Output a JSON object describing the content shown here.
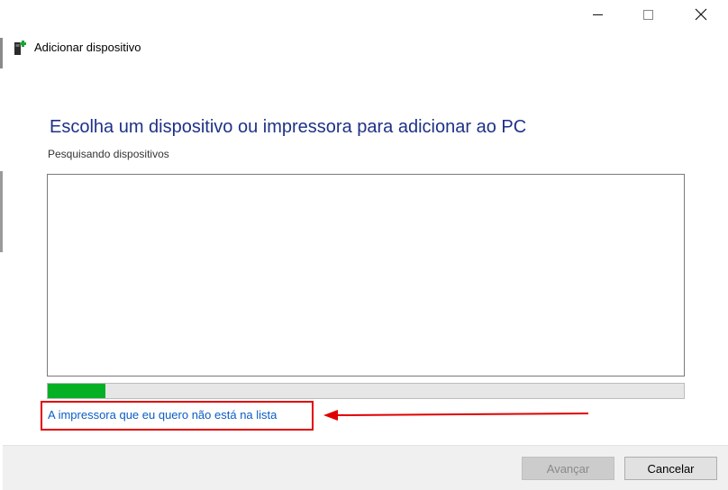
{
  "window": {
    "title": "Adicionar dispositivo",
    "controls": {
      "minimize": "minimize",
      "maximize": "maximize",
      "close": "close"
    },
    "icon": "device-printer-add-icon"
  },
  "main": {
    "heading": "Escolha um dispositivo ou impressora para adicionar ao PC",
    "status": "Pesquisando dispositivos",
    "device_list_items": [],
    "progress_percent": 9,
    "missing_printer_link": "A impressora que eu quero não está na lista"
  },
  "annotation": {
    "highlight_color": "#e00000",
    "arrow_color": "#e00000"
  },
  "footer": {
    "next_label": "Avançar",
    "next_enabled": false,
    "cancel_label": "Cancelar"
  },
  "colors": {
    "heading": "#1e3287",
    "link": "#0b5cc4",
    "progress": "#06b025"
  }
}
